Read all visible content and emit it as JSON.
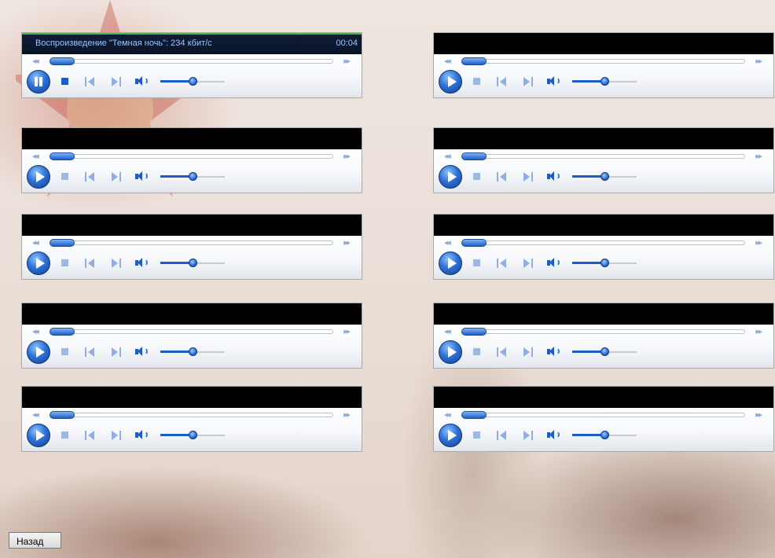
{
  "players": [
    {
      "id": "p1",
      "status_text": "Воспроизведение \"Темная ночь\": 234 кбит/с",
      "time": "00:04",
      "state": "playing",
      "progress": 0.0,
      "volume": 0.5
    },
    {
      "id": "p2",
      "status_text": "",
      "time": "",
      "state": "stopped",
      "progress": 0.0,
      "volume": 0.5
    },
    {
      "id": "p3",
      "status_text": "",
      "time": "",
      "state": "stopped",
      "progress": 0.0,
      "volume": 0.5
    },
    {
      "id": "p4",
      "status_text": "",
      "time": "",
      "state": "stopped",
      "progress": 0.0,
      "volume": 0.5
    },
    {
      "id": "p5",
      "status_text": "",
      "time": "",
      "state": "stopped",
      "progress": 0.0,
      "volume": 0.5
    },
    {
      "id": "p6",
      "status_text": "",
      "time": "",
      "state": "stopped",
      "progress": 0.0,
      "volume": 0.5
    },
    {
      "id": "p7",
      "status_text": "",
      "time": "",
      "state": "stopped",
      "progress": 0.0,
      "volume": 0.5
    },
    {
      "id": "p8",
      "status_text": "",
      "time": "",
      "state": "stopped",
      "progress": 0.0,
      "volume": 0.5
    },
    {
      "id": "p9",
      "status_text": "",
      "time": "",
      "state": "stopped",
      "progress": 0.0,
      "volume": 0.5
    },
    {
      "id": "p10",
      "status_text": "",
      "time": "",
      "state": "stopped",
      "progress": 0.0,
      "volume": 0.5
    }
  ],
  "back_button": {
    "label": "Назад"
  },
  "icons": {
    "seek_back": "rewind-icon",
    "seek_forward": "fast-forward-icon",
    "play": "play-icon",
    "pause": "pause-icon",
    "stop": "stop-icon",
    "prev": "previous-track-icon",
    "next": "next-track-icon",
    "volume": "volume-icon"
  },
  "colors": {
    "accent": "#1c5cc6",
    "status_text": "#9cc6ff",
    "status_bar": "#0e1d38"
  }
}
